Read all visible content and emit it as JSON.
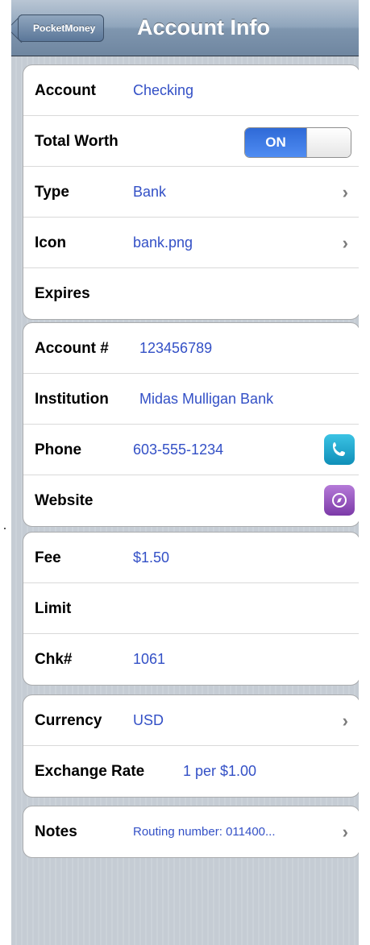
{
  "nav": {
    "back_label": "PocketMoney",
    "title": "Account Info"
  },
  "group1": {
    "account": {
      "label": "Account",
      "value": "Checking"
    },
    "total_worth": {
      "label": "Total Worth",
      "toggle": "ON"
    },
    "type": {
      "label": "Type",
      "value": "Bank"
    },
    "icon": {
      "label": "Icon",
      "value": "bank.png"
    },
    "expires": {
      "label": "Expires",
      "value": ""
    }
  },
  "group2": {
    "account_num": {
      "label": "Account #",
      "value": "123456789"
    },
    "institution": {
      "label": "Institution",
      "value": "Midas Mulligan Bank"
    },
    "phone": {
      "label": "Phone",
      "value": "603-555-1234"
    },
    "website": {
      "label": "Website",
      "value": ""
    }
  },
  "group3": {
    "fee": {
      "label": "Fee",
      "value": "$1.50"
    },
    "limit": {
      "label": "Limit",
      "value": ""
    },
    "chk": {
      "label": "Chk#",
      "value": "1061"
    }
  },
  "group4": {
    "currency": {
      "label": "Currency",
      "value": "USD"
    },
    "exchange": {
      "label": "Exchange Rate",
      "value": "1 per $1.00"
    }
  },
  "group5": {
    "notes": {
      "label": "Notes",
      "value": "Routing number: 011400..."
    }
  },
  "colors": {
    "value_blue": "#3350c6",
    "toggle_blue": "#2f6ad7",
    "phone_icon": "#1fa9d2",
    "web_icon": "#9a55c4"
  }
}
